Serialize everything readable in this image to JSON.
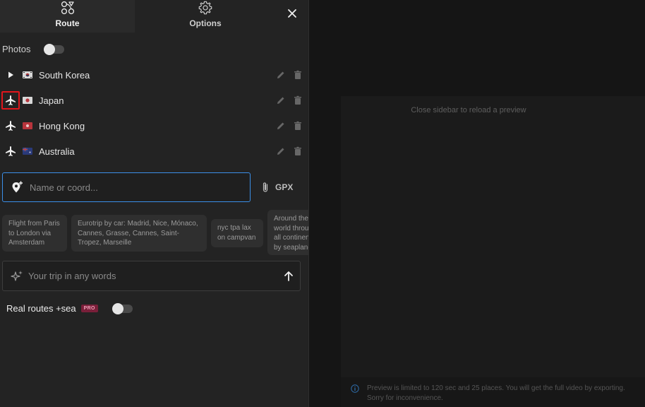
{
  "tabs": {
    "route_label": "Route",
    "options_label": "Options"
  },
  "photos": {
    "label": "Photos",
    "enabled": false
  },
  "places": [
    {
      "name": "South Korea",
      "transport_icon": "play-icon",
      "flag": "south-korea-flag"
    },
    {
      "name": "Japan",
      "transport_icon": "airplane-icon",
      "flag": "japan-flag"
    },
    {
      "name": "Hong Kong",
      "transport_icon": "airplane-icon",
      "flag": "hong-kong-flag"
    },
    {
      "name": "Australia",
      "transport_icon": "airplane-icon",
      "flag": "australia-flag"
    }
  ],
  "search": {
    "placeholder": "Name or coord...",
    "value": ""
  },
  "gpx_label": "GPX",
  "suggestions": [
    "Flight from Paris to London via Amsterdam",
    "Eurotrip by car: Madrid, Nice, Mónaco, Cannes, Grasse, Cannes, Saint-Tropez, Marseille",
    "nyc tpa lax on campvan",
    "Around the world through all continents by seaplane"
  ],
  "ai_prompt": {
    "placeholder": "Your trip in any words",
    "value": ""
  },
  "real_routes": {
    "label": "Real routes +sea",
    "badge": "PRO",
    "enabled": false
  },
  "preview": {
    "message": "Close sidebar to reload a preview",
    "notice_line1": "Preview is limited to 120 sec and 25 places. You will get the full video by exporting.",
    "notice_line2": "Sorry for inconvenience."
  },
  "colors": {
    "accent": "#3b8fe8",
    "selection": "#e0161c",
    "pro_badge": "#7a1f3a"
  }
}
